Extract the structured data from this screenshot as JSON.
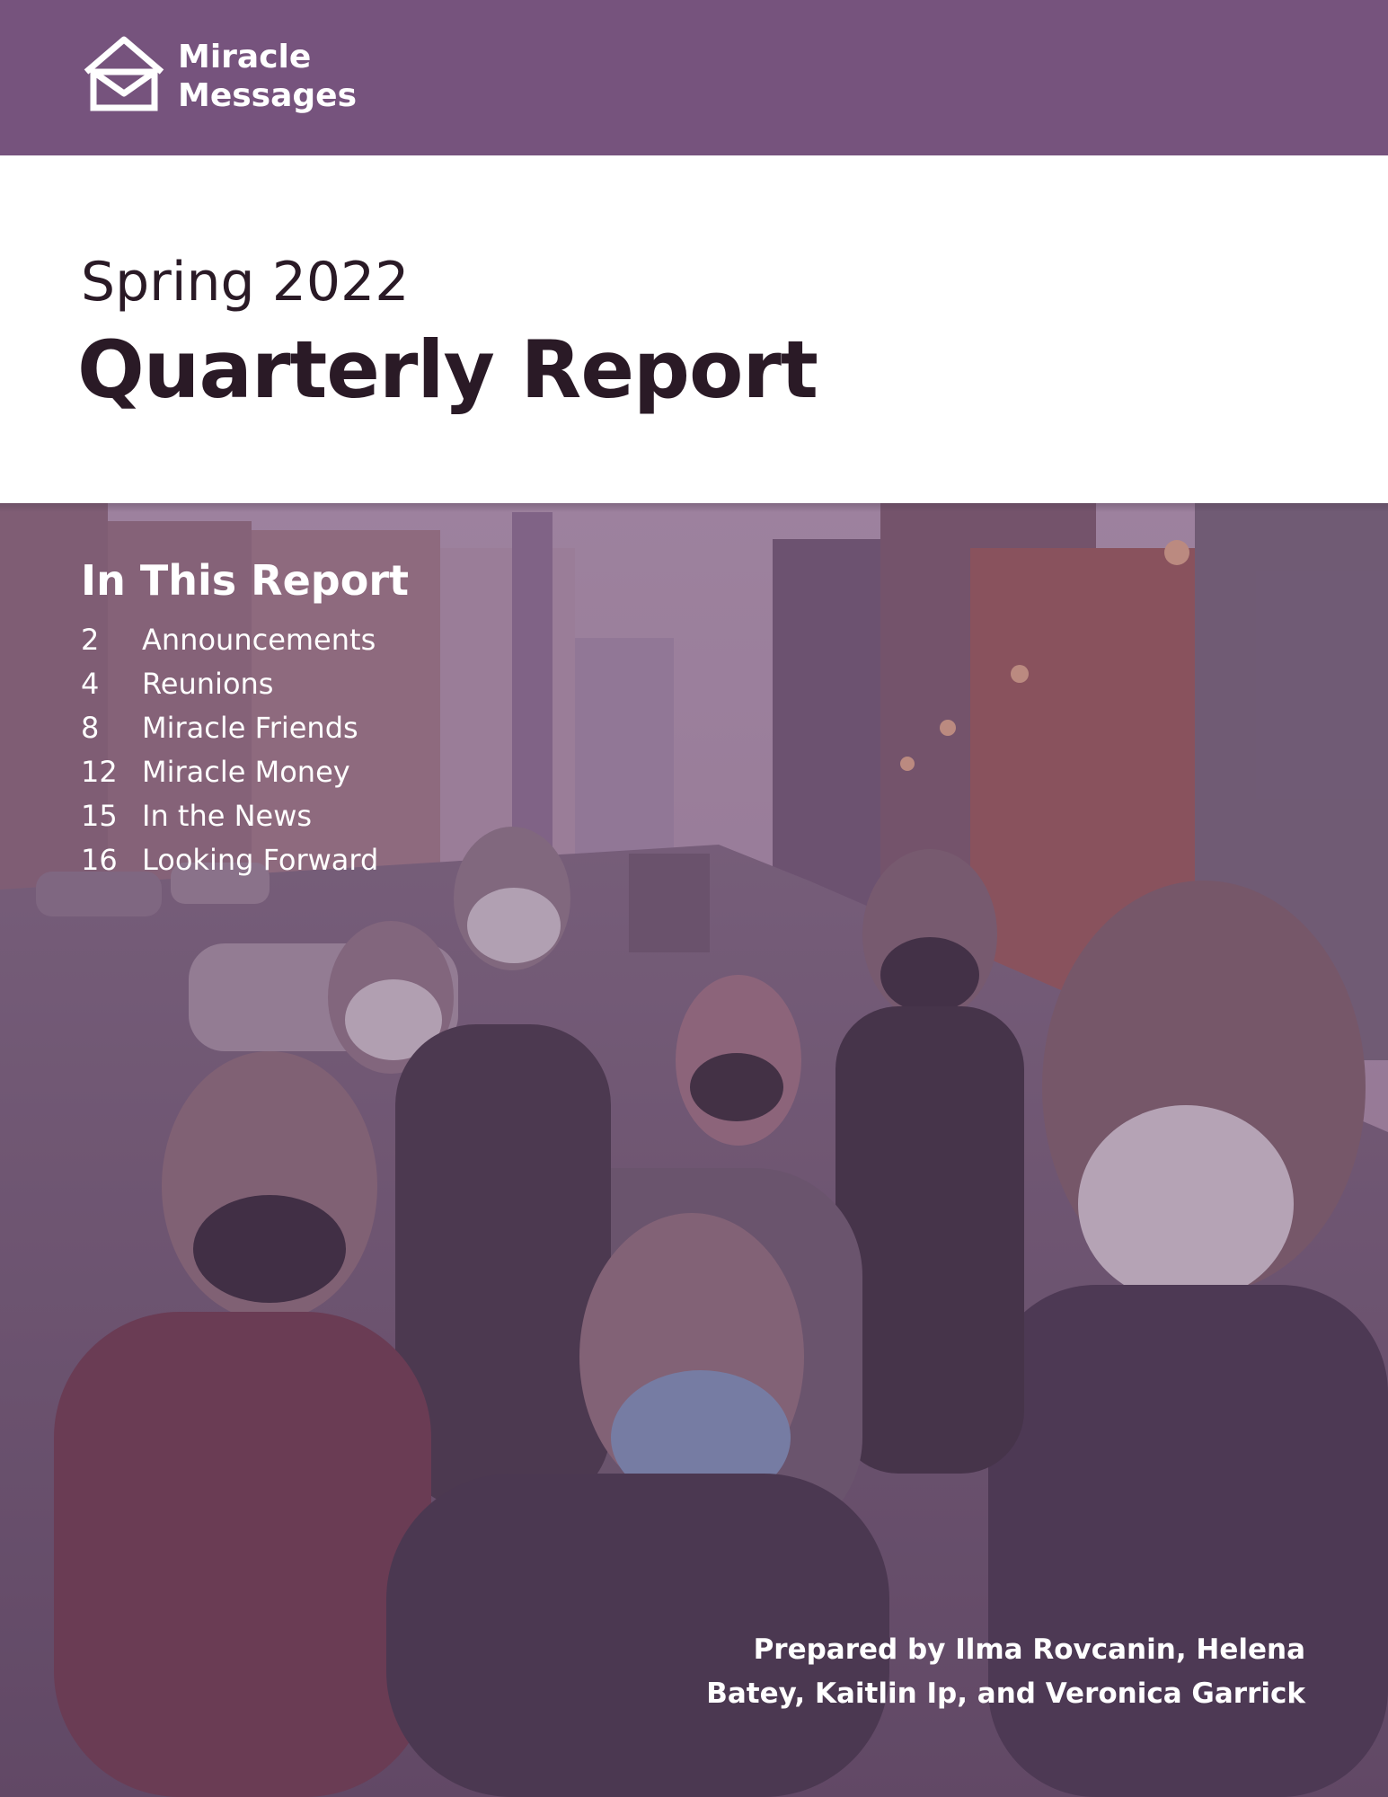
{
  "brand": {
    "name_line1": "Miracle",
    "name_line2": "Messages",
    "color": "#76537d",
    "icon": "house-envelope-icon"
  },
  "cover": {
    "subtitle": "Spring 2022",
    "title": "Quarterly Report"
  },
  "toc": {
    "heading": "In This Report",
    "items": [
      {
        "page": "2",
        "label": "Announcements"
      },
      {
        "page": "4",
        "label": "Reunions"
      },
      {
        "page": "8",
        "label": "Miracle Friends"
      },
      {
        "page": "12",
        "label": "Miracle Money"
      },
      {
        "page": "15",
        "label": "In the News"
      },
      {
        "page": "16",
        "label": "Looking Forward"
      }
    ]
  },
  "credits": {
    "line1": "Prepared by Ilma Rovcanin, Helena",
    "line2": "Batey, Kaitlin Ip, and Veronica Garrick"
  }
}
